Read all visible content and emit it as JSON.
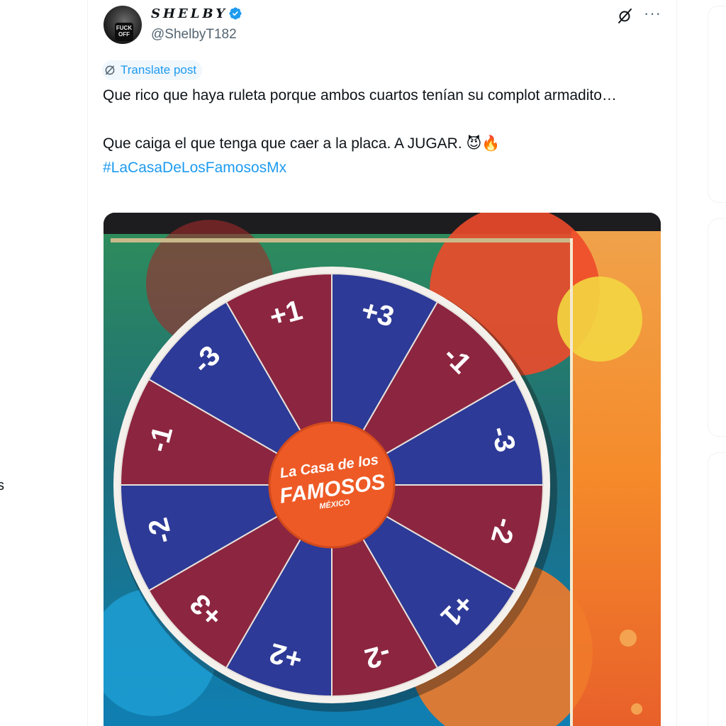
{
  "post": {
    "display_name": "SHELBY",
    "handle": "@ShelbyT182",
    "avatar_text": "FUCK OFF",
    "translate_label": "Translate post",
    "text_line1": "Que rico que haya ruleta porque ambos cuartos tenían su complot armadito…",
    "text_line2": "Que caiga el que tenga que caer a la placa. A JUGAR. 😈🔥",
    "hashtag": "#LaCasaDeLosFamososMx",
    "icons": [
      "verified-badge-icon",
      "grok-icon",
      "more-icon",
      "translate-icon"
    ]
  },
  "media": {
    "wheel_segments": [
      "+3",
      "-1",
      "-3",
      "-2",
      "+1",
      "-2",
      "+2",
      "+3",
      "-2",
      "-1",
      "-3",
      "+1"
    ],
    "wheel_logo_line1": "La Casa de los",
    "wheel_logo_line2": "FAMOSOS",
    "wheel_logo_line3": "MÉXICO",
    "colors": {
      "blue": "#2d3a97",
      "red": "#8c2540",
      "logo": "#ee5a26"
    }
  },
  "colors": {
    "accent": "#1d9bf0",
    "text": "#0f1419",
    "muted": "#536471"
  }
}
